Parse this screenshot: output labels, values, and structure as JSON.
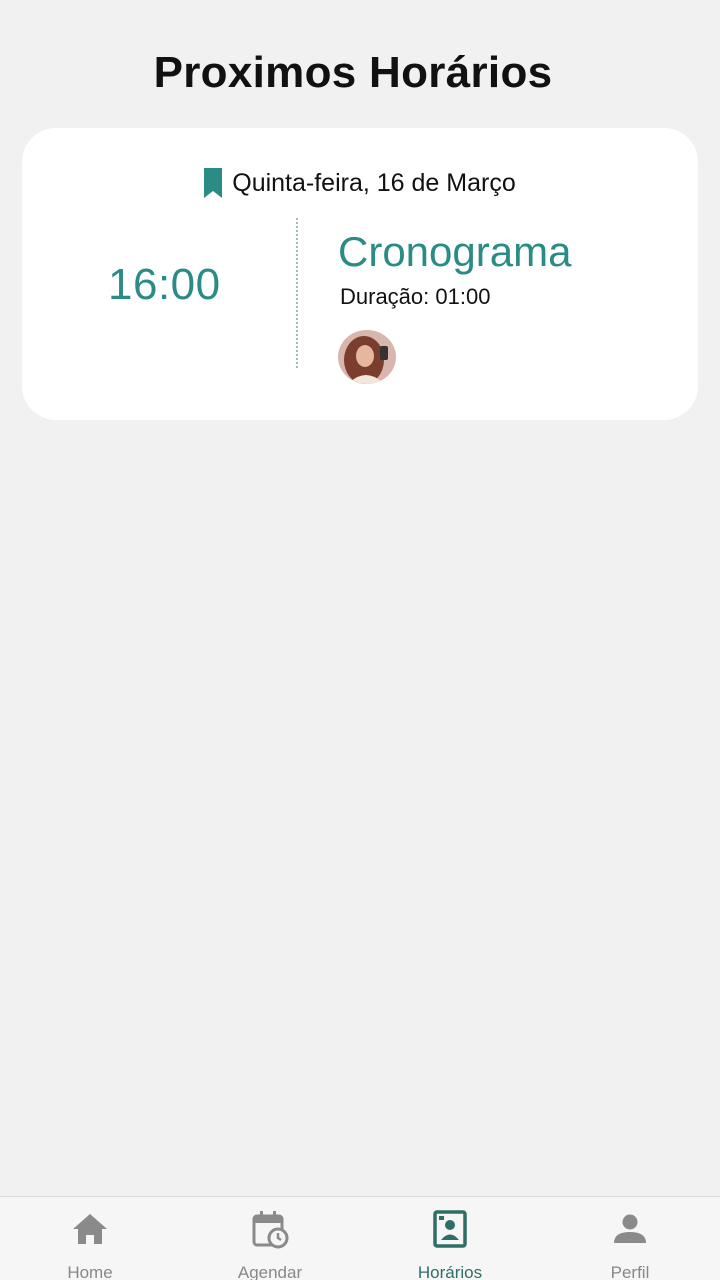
{
  "header": {
    "title": "Proximos Horários"
  },
  "appointment": {
    "date": "Quinta-feira, 16 de Março",
    "time": "16:00",
    "service": "Cronograma",
    "duration": "Duração: 01:00"
  },
  "bottom_nav": {
    "items": [
      {
        "label": "Home",
        "icon": "home-icon"
      },
      {
        "label": "Agendar",
        "icon": "calendar-clock-icon"
      },
      {
        "label": "Horários",
        "icon": "portrait-schedule-icon",
        "active": true
      },
      {
        "label": "Perfil",
        "icon": "person-icon"
      }
    ]
  },
  "colors": {
    "accent": "#2a8c84",
    "background": "#f1f1f1",
    "card": "#ffffff",
    "nav_inactive": "#888888",
    "nav_active": "#2f6e66"
  }
}
